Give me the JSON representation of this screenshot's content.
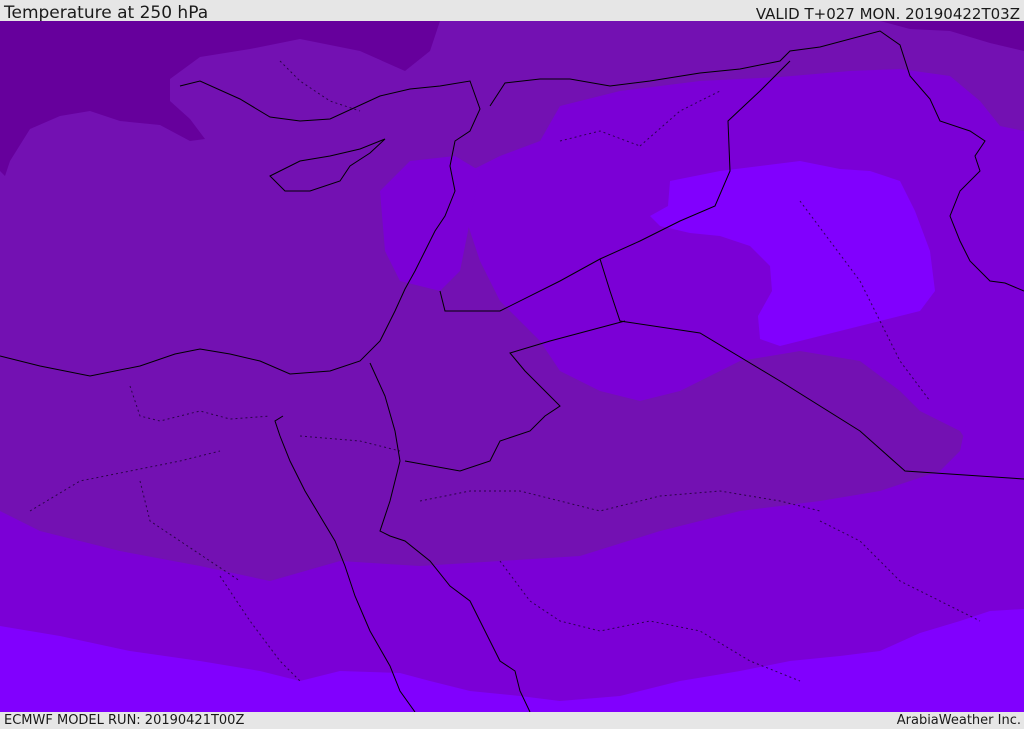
{
  "header": {
    "title": "Temperature at 250 hPa",
    "valid": "VALID T+027 MON. 20190422T03Z"
  },
  "footer": {
    "model_run": "ECMWF MODEL RUN: 20190421T00Z",
    "credit": "ArabiaWeather Inc."
  },
  "colors": {
    "band_darkest": "#66009c",
    "band_dark": "#7311b2",
    "band_mid": "#7b00d6",
    "band_light": "#8100fe",
    "coastline": "#000000"
  }
}
